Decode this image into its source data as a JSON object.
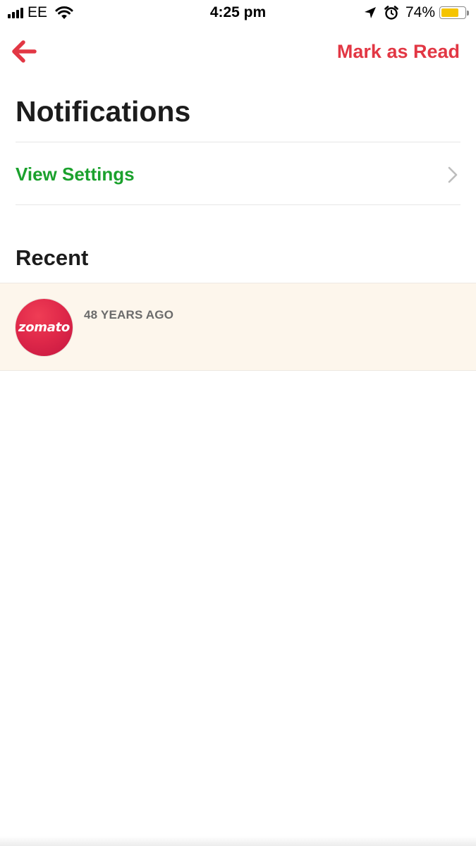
{
  "status_bar": {
    "carrier": "EE",
    "time": "4:25 pm",
    "battery_percent": "74%",
    "battery_level": 0.74,
    "battery_color": "#f5c400"
  },
  "nav": {
    "back_icon": "arrow-left-icon",
    "mark_read_label": "Mark as Read"
  },
  "page": {
    "title": "Notifications",
    "settings_label": "View Settings",
    "recent_heading": "Recent"
  },
  "notifications": [
    {
      "avatar_text": "zomato",
      "time": "48 YEARS AGO"
    }
  ],
  "colors": {
    "accent_red": "#e23744",
    "settings_green": "#1ba12d",
    "notification_bg": "#fdf6ec"
  }
}
